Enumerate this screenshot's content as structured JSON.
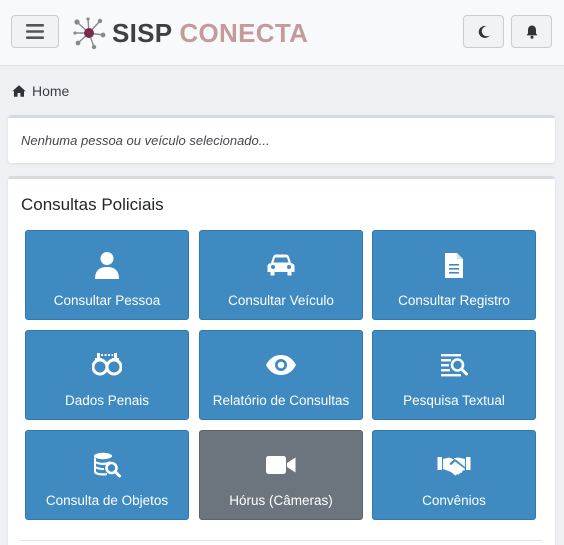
{
  "header": {
    "brand_part1": "SISP",
    "brand_part2": "CONECTA",
    "menu_icon": "hamburger-icon",
    "theme_icon": "moon-icon",
    "notifications_icon": "bell-icon"
  },
  "breadcrumb": {
    "home_label": "Home"
  },
  "selection": {
    "text": "Nenhuma pessoa ou veículo selecionado..."
  },
  "consultas": {
    "title": "Consultas Policiais",
    "tiles": [
      {
        "label": "Consultar Pessoa",
        "icon": "user-icon",
        "color": "#3f8bc1"
      },
      {
        "label": "Consultar Veículo",
        "icon": "car-icon",
        "color": "#3f8bc1"
      },
      {
        "label": "Consultar Registro",
        "icon": "document-icon",
        "color": "#3f8bc1"
      },
      {
        "label": "Dados Penais",
        "icon": "handcuffs-icon",
        "color": "#3f8bc1"
      },
      {
        "label": "Relatório de Consultas",
        "icon": "eye-icon",
        "color": "#3f8bc1"
      },
      {
        "label": "Pesquisa Textual",
        "icon": "text-search-icon",
        "color": "#3f8bc1"
      },
      {
        "label": "Consulta de Objetos",
        "icon": "database-search-icon",
        "color": "#3f8bc1"
      },
      {
        "label": "Hórus (Câmeras)",
        "icon": "video-camera-icon",
        "color": "#6c757d"
      },
      {
        "label": "Convênios",
        "icon": "handshake-icon",
        "color": "#3f8bc1"
      }
    ]
  }
}
